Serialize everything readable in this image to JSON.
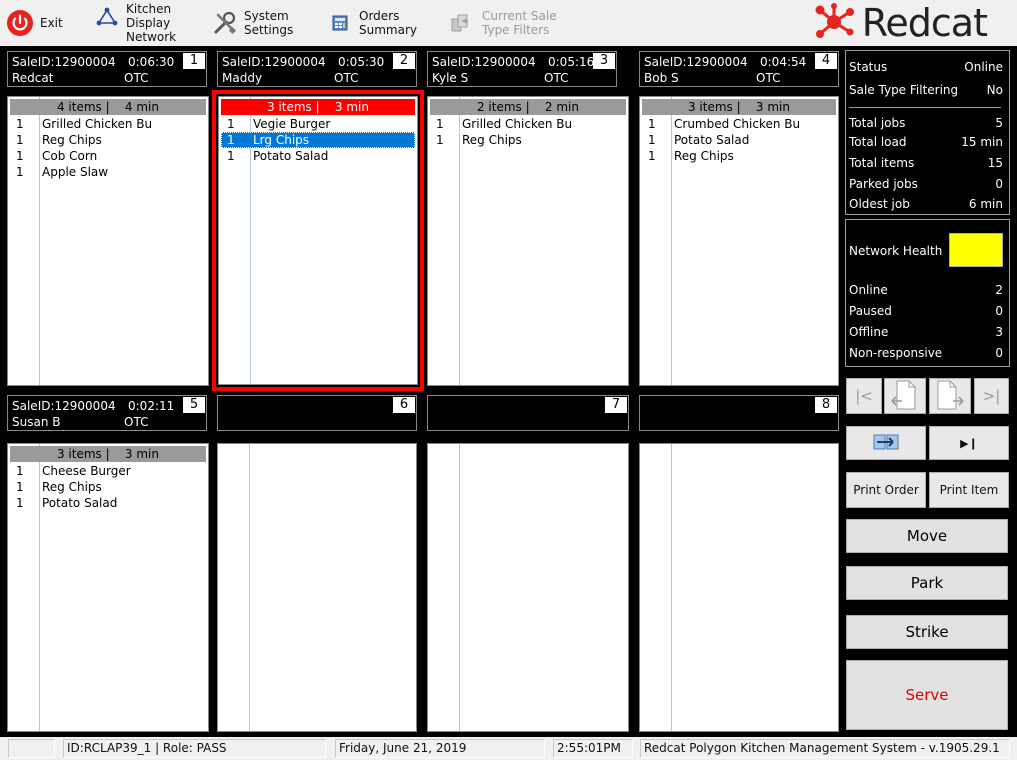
{
  "toolbar": {
    "exit": "Exit",
    "kdn": [
      "Kitchen",
      "Display",
      "Network"
    ],
    "settings": [
      "System",
      "Settings"
    ],
    "summary": [
      "Orders",
      "Summary"
    ],
    "filters": [
      "Current Sale",
      "Type Filters"
    ],
    "brand": "Redcat",
    "brand_color": "#ff0000"
  },
  "orders": [
    {
      "slot": "1",
      "sale": "SaleID:12900004",
      "time": "0:06:30",
      "who": "Redcat",
      "type": "OTC",
      "summary": "4 items |    4 min",
      "items": [
        {
          "q": "1",
          "n": "Grilled Chicken Bu"
        },
        {
          "q": "1",
          "n": "Reg Chips"
        },
        {
          "q": "1",
          "n": "Cob Corn"
        },
        {
          "q": "1",
          "n": "Apple Slaw"
        }
      ]
    },
    {
      "slot": "2",
      "sale": "SaleID:12900004",
      "time": "0:05:30",
      "who": "Maddy",
      "type": "OTC",
      "summary": "3 items |    3 min",
      "items": [
        {
          "q": "1",
          "n": "Vegie Burger"
        },
        {
          "q": "1",
          "n": "Lrg Chips"
        },
        {
          "q": "1",
          "n": "Potato Salad"
        }
      ]
    },
    {
      "slot": "3",
      "sale": "SaleID:12900004",
      "time": "0:05:16",
      "who": "Kyle S",
      "type": "OTC",
      "summary": "2 items |    2 min",
      "items": [
        {
          "q": "1",
          "n": "Grilled Chicken Bu"
        },
        {
          "q": "1",
          "n": "Reg Chips"
        }
      ]
    },
    {
      "slot": "4",
      "sale": "SaleID:12900004",
      "time": "0:04:54",
      "who": "Bob S",
      "type": "OTC",
      "summary": "3 items |    3 min",
      "items": [
        {
          "q": "1",
          "n": "Crumbed Chicken Bu"
        },
        {
          "q": "1",
          "n": "Potato Salad"
        },
        {
          "q": "1",
          "n": "Reg Chips"
        }
      ]
    },
    {
      "slot": "5",
      "sale": "SaleID:12900004",
      "time": "0:02:11",
      "who": "Susan B",
      "type": "OTC",
      "summary": "3 items |    3 min",
      "items": [
        {
          "q": "1",
          "n": "Cheese Burger"
        },
        {
          "q": "1",
          "n": "Reg Chips"
        },
        {
          "q": "1",
          "n": "Potato Salad"
        }
      ]
    }
  ],
  "empty_slots": [
    "6",
    "7",
    "8"
  ],
  "status_panel": {
    "status_label": "Status",
    "status_value": "Online",
    "filter_label": "Sale Type Filtering",
    "filter_value": "No",
    "total_jobs_label": "Total jobs",
    "total_jobs": "5",
    "total_load_label": "Total load",
    "total_load": "15 min",
    "total_items_label": "Total items",
    "total_items": "15",
    "parked_label": "Parked jobs",
    "parked": "0",
    "oldest_label": "Oldest job",
    "oldest": "6 min"
  },
  "network_panel": {
    "health_label": "Network Health",
    "health_color": "#ffff00",
    "online_label": "Online",
    "online": "2",
    "paused_label": "Paused",
    "paused": "0",
    "offline_label": "Offline",
    "offline": "3",
    "nonresp_label": "Non-responsive",
    "nonresp": "0"
  },
  "buttons": {
    "print_order": "Print Order",
    "print_item": "Print Item",
    "move": "Move",
    "park": "Park",
    "strike": "Strike",
    "serve": "Serve"
  },
  "statusbar": {
    "id_role": "ID:RCLAP39_1 | Role: PASS",
    "date": "Friday, June 21, 2019",
    "time": "2:55:01PM",
    "product": "Redcat Polygon Kitchen Management System - v.1905.29.1"
  }
}
